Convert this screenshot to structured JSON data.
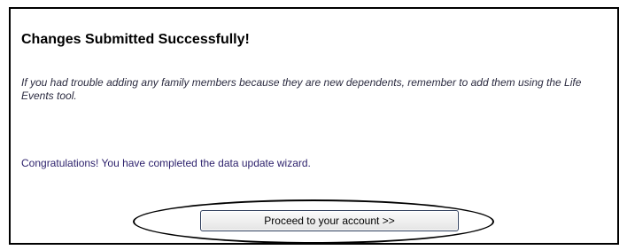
{
  "confirmation": {
    "heading": "Changes Submitted Successfully!",
    "note": "If you had trouble adding any family members because they are new dependents, remember to add them using the Life Events tool.",
    "congrats": "Congratulations! You have completed the data update wizard.",
    "proceed_label": "Proceed to your account >>"
  }
}
